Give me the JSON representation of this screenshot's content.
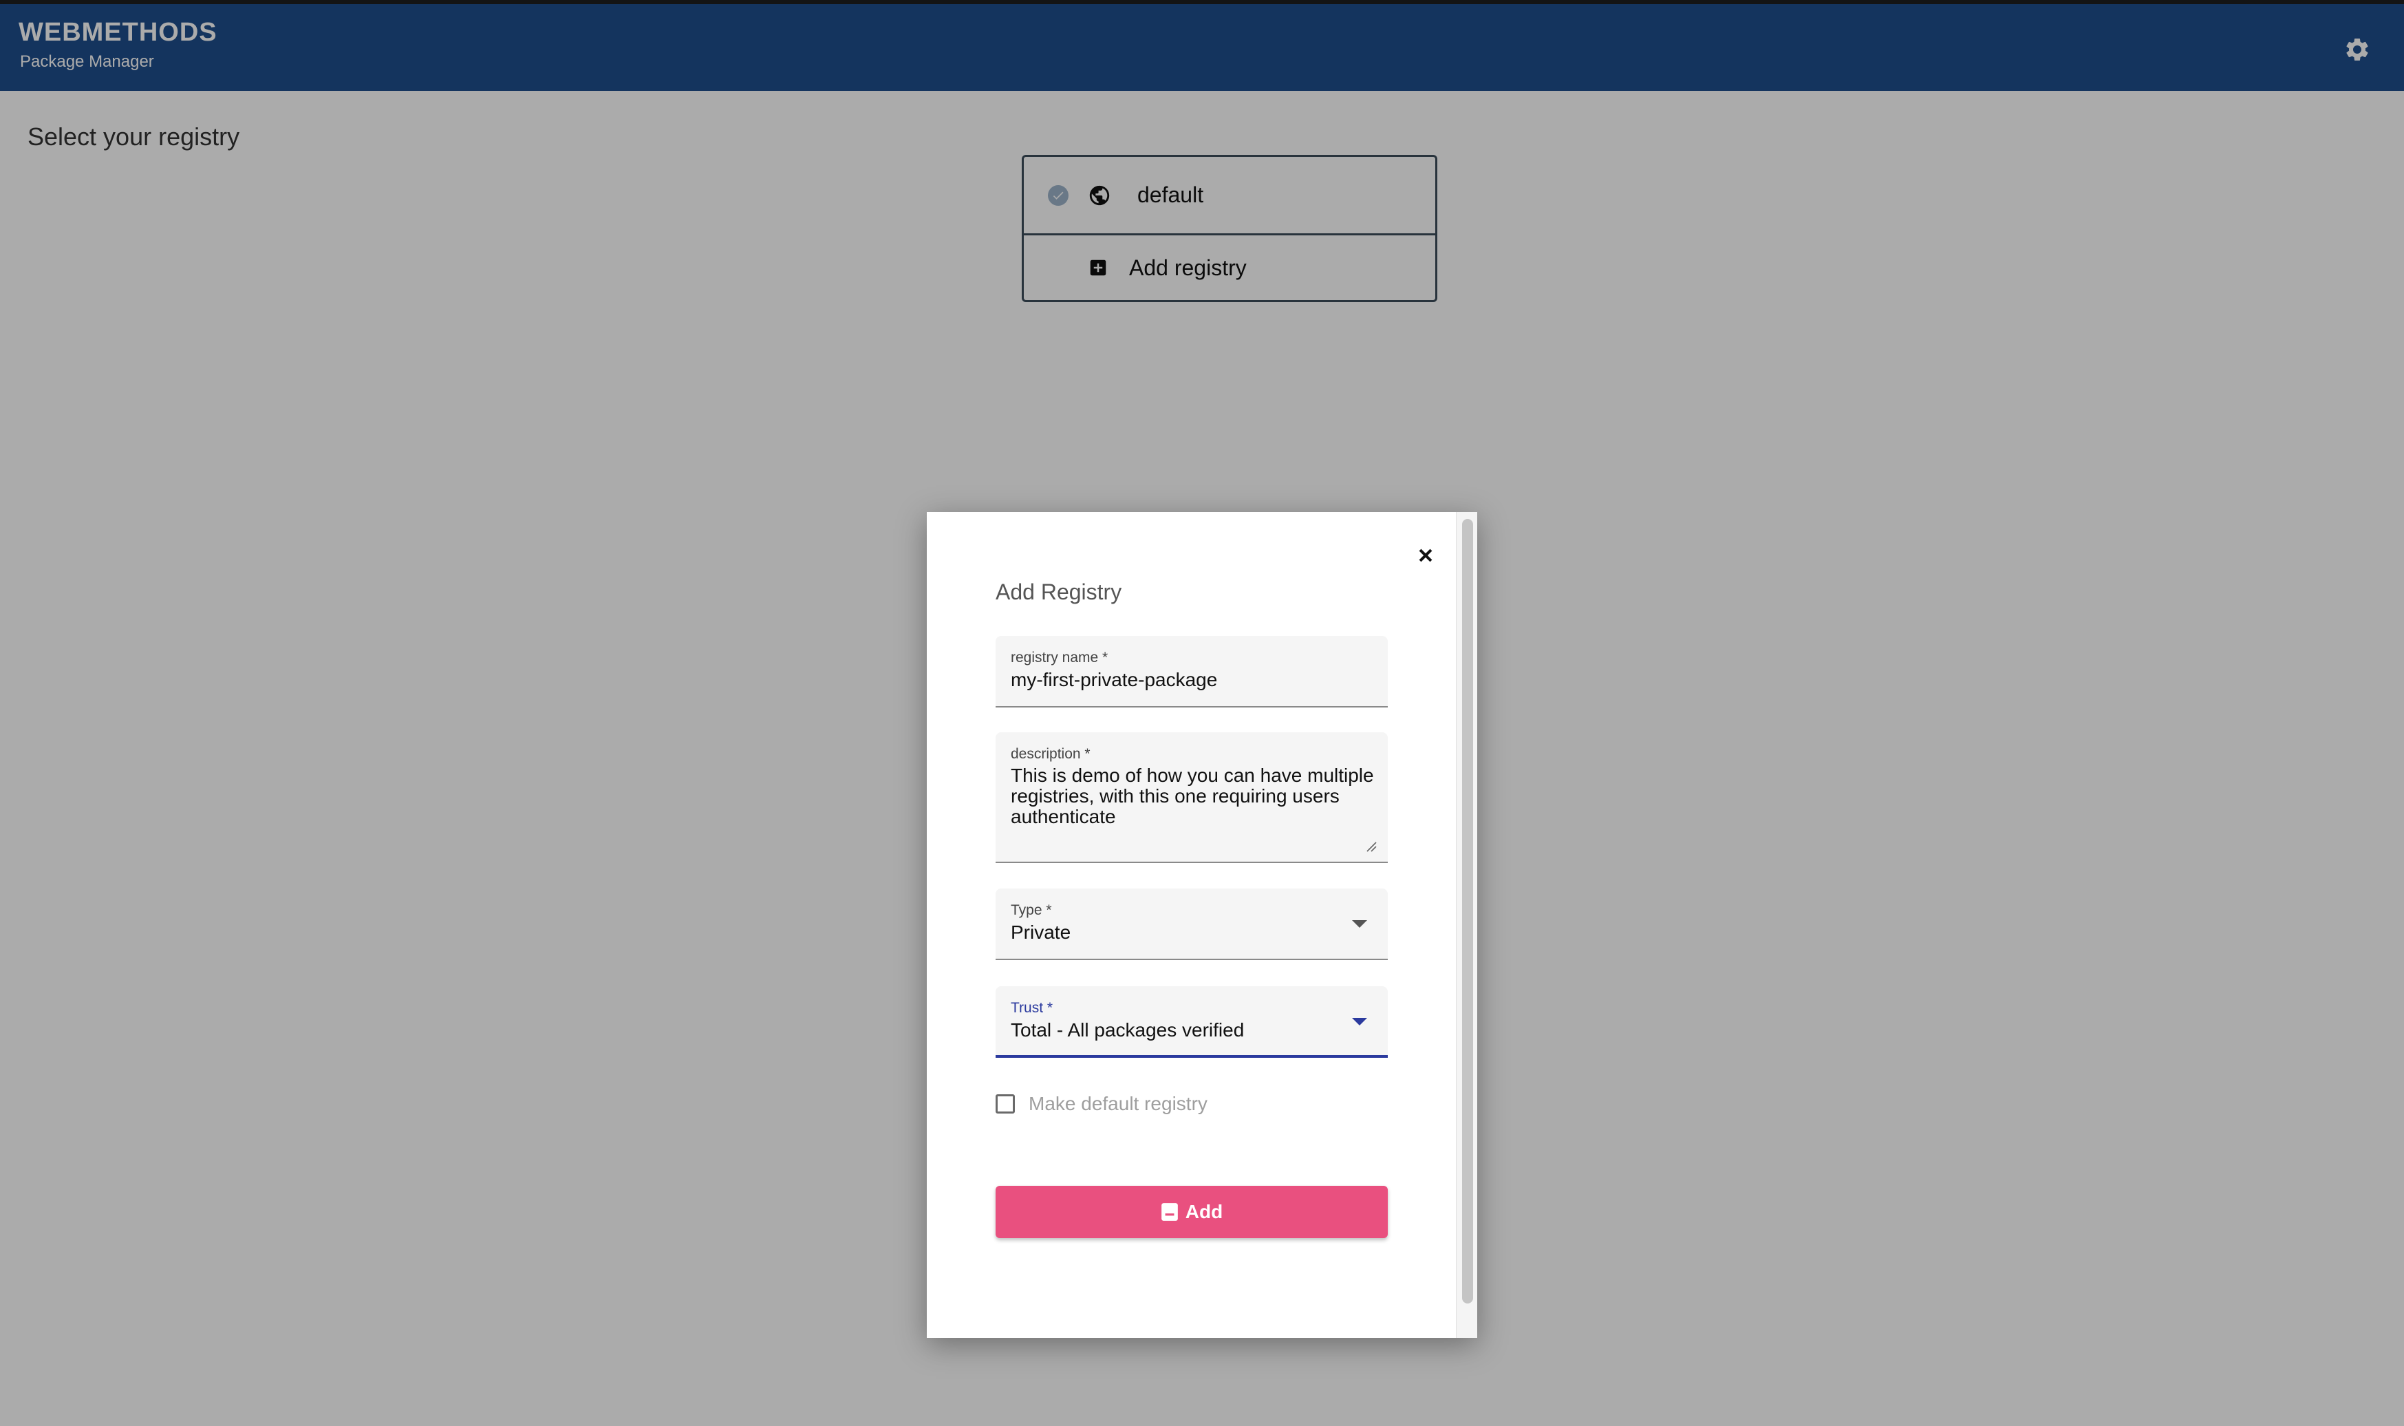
{
  "header": {
    "brand_title": "WEBMETHODS",
    "brand_subtitle": "Package Manager",
    "settings_icon": "gear-icon"
  },
  "page": {
    "heading": "Select your registry"
  },
  "registry_list": {
    "items": [
      {
        "label": "default",
        "selected": true,
        "icon": "globe-icon"
      },
      {
        "label": "Add registry",
        "icon": "plus-square-icon"
      }
    ]
  },
  "modal": {
    "title": "Add Registry",
    "close_icon": "close-icon",
    "fields": {
      "registry_name": {
        "label": "registry name *",
        "value": "my-first-private-package"
      },
      "description": {
        "label": "description *",
        "value": "This is demo of how you can have multiple registries, with this one requiring users authenticate"
      },
      "type": {
        "label": "Type *",
        "value": "Private"
      },
      "trust": {
        "label": "Trust *",
        "value": "Total - All packages verified"
      }
    },
    "default_checkbox": {
      "label": "Make default registry",
      "checked": false
    },
    "add_button": {
      "label": "Add",
      "icon": "save-icon"
    }
  },
  "colors": {
    "header_bg": "#1f4e8c",
    "accent_button": "#e9507f",
    "focus": "#2b3a9e"
  }
}
